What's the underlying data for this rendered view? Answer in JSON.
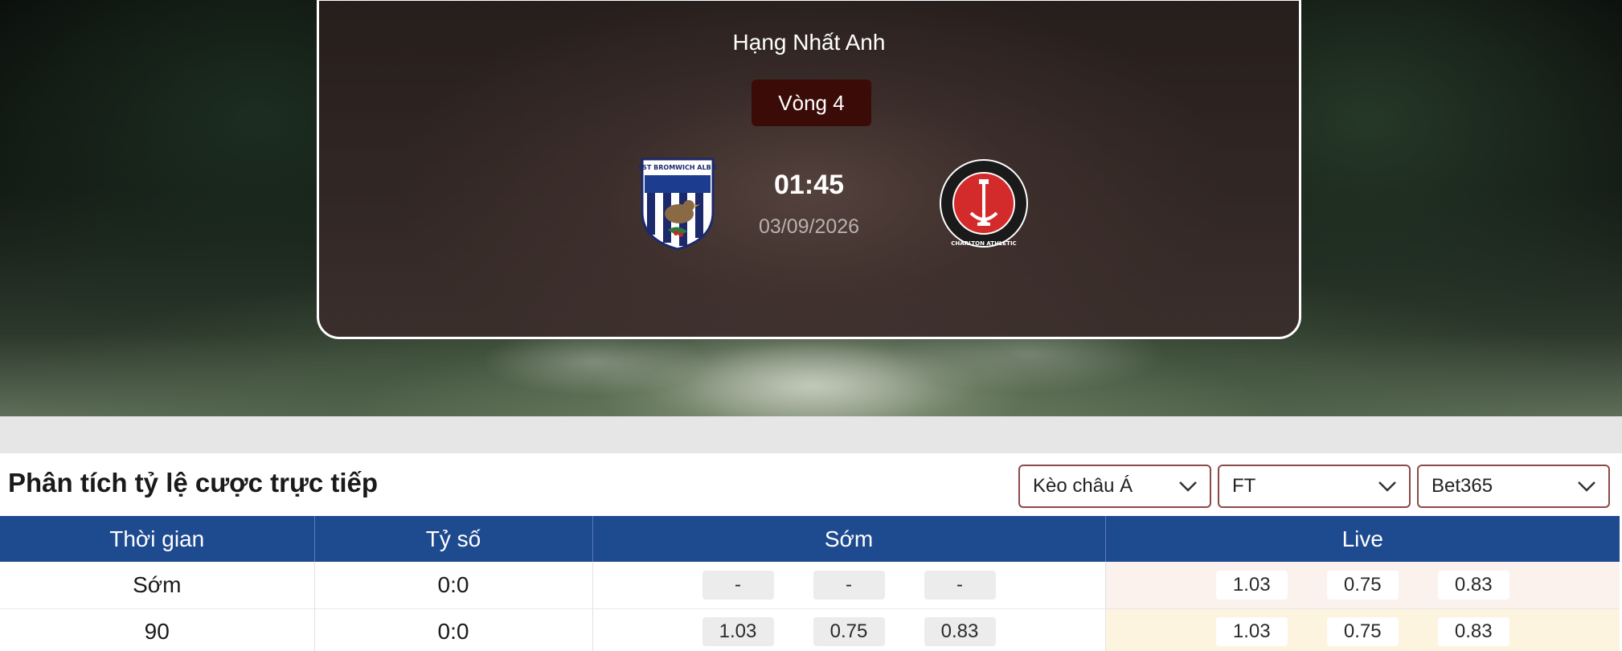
{
  "match": {
    "league": "Hạng Nhất Anh",
    "round": "Vòng 4",
    "time": "01:45",
    "date": "03/09/2026",
    "home_team_logo": "West Bromwich Albion crest",
    "home_logo_text": "WEST BROMWICH ALBION",
    "away_team_logo": "Charlton Athletic crest",
    "away_logo_text": "CHARLTON ATHLETIC"
  },
  "odds": {
    "title": "Phân tích tỷ lệ cược trực tiếp",
    "filters": {
      "market": "Kèo châu Á",
      "period": "FT",
      "bookmaker": "Bet365"
    },
    "columns": [
      "Thời gian",
      "Tỷ số",
      "Sớm",
      "Live"
    ],
    "rows": [
      {
        "time": "Sớm",
        "score": "0:0",
        "early": [
          "-",
          "-",
          "-"
        ],
        "live": [
          "1.03",
          "0.75",
          "0.83"
        ]
      },
      {
        "time": "90",
        "score": "0:0",
        "early": [
          "1.03",
          "0.75",
          "0.83"
        ],
        "live": [
          "1.03",
          "0.75",
          "0.83"
        ]
      }
    ]
  },
  "colors": {
    "table_header": "#1e4a90",
    "round_badge": "#3a0b07",
    "select_border": "#8a4a48",
    "live_row_early_bg": "#fbf1ed",
    "live_row_90_bg": "#fdf4df"
  },
  "icons": [
    "chevron-down-icon",
    "west-brom-crest-icon",
    "charlton-crest-icon"
  ]
}
